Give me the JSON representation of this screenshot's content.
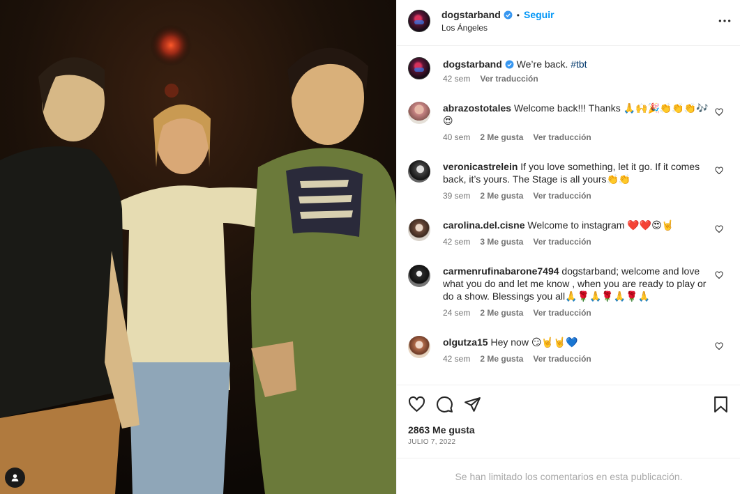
{
  "post": {
    "username": "dogstarband",
    "follow_label": "Seguir",
    "location": "Los Ángeles",
    "caption_text": "We’re back. ",
    "caption_hashtag": "#tbt",
    "caption_time": "42 sem",
    "caption_translate": "Ver traducción",
    "likes": "2863 Me gusta",
    "date": "JULIO 7, 2022",
    "comments_limited": "Se han limitado los comentarios en esta publicación."
  },
  "comments": [
    {
      "user": "abrazostotales",
      "text": "Welcome back!!! Thanks 🙏🙌🎉👏👏👏🎶😍",
      "time": "40 sem",
      "likes": "2 Me gusta",
      "translate": "Ver traducción"
    },
    {
      "user": "veronicastrelein",
      "text": "If you love something, let it go. If it comes back, it’s yours. The Stage is all yours👏👏",
      "time": "39 sem",
      "likes": "2 Me gusta",
      "translate": "Ver traducción"
    },
    {
      "user": "carolina.del.cisne",
      "text": "Welcome to instagram ❤️❤️😍🤘",
      "time": "42 sem",
      "likes": "3 Me gusta",
      "translate": "Ver traducción"
    },
    {
      "user": "carmenrufinabarone7494",
      "text": "dogstarband; welcome and love what you do and let me know , when you are ready to play or do a show. Blessings you all🙏🌹🙏🌹🙏🌹🙏",
      "time": "24 sem",
      "likes": "2 Me gusta",
      "translate": "Ver traducción"
    },
    {
      "user": "olgutza15",
      "text": "Hey now 😏🤘🤘💙",
      "time": "42 sem",
      "likes": "2 Me gusta",
      "translate": "Ver traducción"
    }
  ],
  "colors": {
    "accent": "#0095f6",
    "verified": "#3897f0",
    "muted": "#737373"
  },
  "icons": [
    "more-options-icon",
    "heart-icon",
    "comment-icon",
    "share-icon",
    "bookmark-icon",
    "user-tag-icon",
    "verified-badge-icon"
  ]
}
